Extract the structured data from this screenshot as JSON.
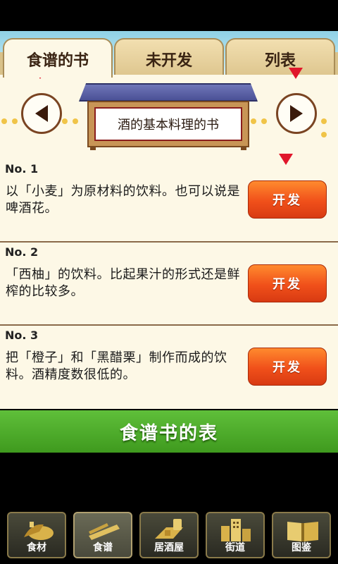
{
  "tabs": [
    {
      "label": "食谱的书",
      "active": true
    },
    {
      "label": "未开发",
      "active": false
    },
    {
      "label": "列表",
      "active": false
    }
  ],
  "sign": {
    "title": "酒的基本料理的书"
  },
  "items": [
    {
      "no": "No. 1",
      "desc": "以「小麦」为原材料的饮料。也可以说是啤酒花。",
      "button": "开发"
    },
    {
      "no": "No. 2",
      "desc": "「西柚」的饮料。比起果汁的形式还是鲜榨的比较多。",
      "button": "开发"
    },
    {
      "no": "No. 3",
      "desc": "把「橙子」和「黑醋栗」制作而成的饮料。酒精度数很低的。",
      "button": "开发"
    }
  ],
  "list_button": "食谱书的表",
  "bottom_nav": [
    {
      "label": "食材",
      "icon": "ingredients-icon",
      "active": false
    },
    {
      "label": "食谱",
      "icon": "recipe-icon",
      "active": true
    },
    {
      "label": "居酒屋",
      "icon": "izakaya-icon",
      "active": false
    },
    {
      "label": "街道",
      "icon": "street-icon",
      "active": false
    },
    {
      "label": "图鉴",
      "icon": "book-icon",
      "active": false
    }
  ],
  "colors": {
    "accent": "#f0501a",
    "list_bar": "#4fae2a",
    "marker": "#e0162b"
  }
}
